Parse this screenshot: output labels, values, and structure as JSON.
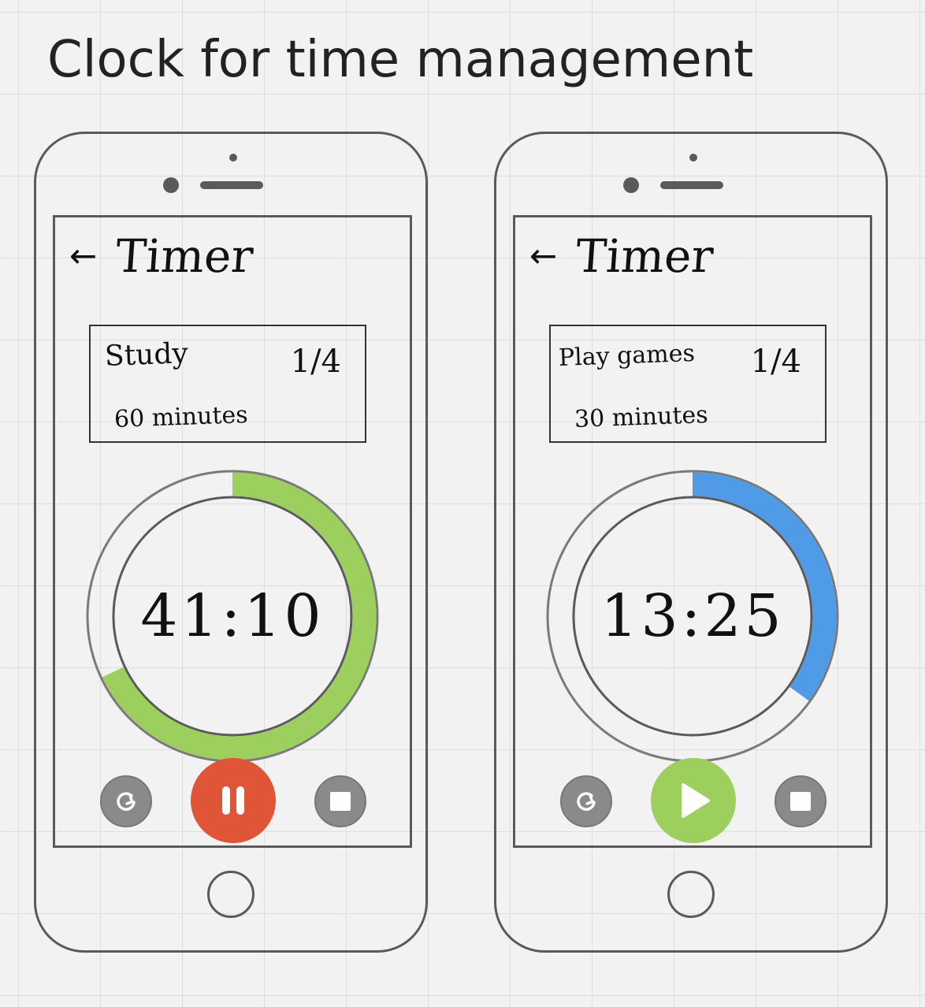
{
  "page": {
    "title": "Clock for time management"
  },
  "colors": {
    "outline": "#5a5a5a",
    "green": "#9ccf5e",
    "blue": "#4f9be8",
    "red": "#e05437",
    "gray_button": "#8a8a8a"
  },
  "phones": [
    {
      "header": {
        "back_icon": "←",
        "title": "Timer"
      },
      "task": {
        "name": "Study",
        "count": "1/4",
        "duration": "60 minutes"
      },
      "timer": {
        "time": "41:10",
        "progress": 0.68,
        "color": "#9ccf5e"
      },
      "controls": {
        "restart_icon": "restart-icon",
        "main_icon": "pause-icon",
        "main_color": "#e05437",
        "stop_icon": "stop-icon"
      }
    },
    {
      "header": {
        "back_icon": "←",
        "title": "Timer"
      },
      "task": {
        "name": "Play games",
        "count": "1/4",
        "duration": "30 minutes"
      },
      "timer": {
        "time": "13:25",
        "progress": 0.35,
        "color": "#4f9be8"
      },
      "controls": {
        "restart_icon": "restart-icon",
        "main_icon": "play-icon",
        "main_color": "#9ccf5e",
        "stop_icon": "stop-icon"
      }
    }
  ]
}
